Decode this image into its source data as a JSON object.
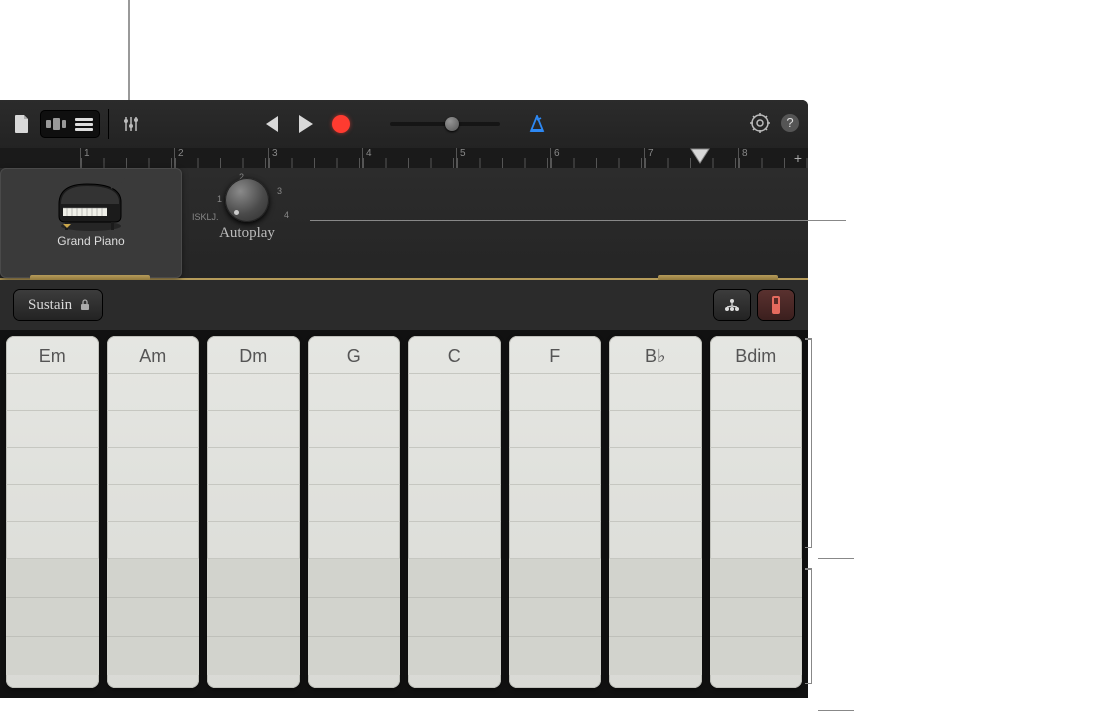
{
  "toolbar": {
    "my_songs_icon": "document",
    "browser_icon": "browser",
    "tracks_icon": "tracks",
    "mixer_icon": "mixer",
    "rewind_icon": "rewind",
    "play_icon": "play",
    "record_icon": "record",
    "metronome_icon": "metronome",
    "settings_icon": "settings",
    "help_icon": "help"
  },
  "ruler": {
    "bars": [
      "1",
      "2",
      "3",
      "4",
      "5",
      "6",
      "7",
      "8"
    ],
    "playhead_bar": 7.9,
    "add_icon": "+"
  },
  "instrument": {
    "name": "Grand Piano"
  },
  "autoplay": {
    "label": "Autoplay",
    "off_label": "ISKLJ.",
    "positions": [
      "1",
      "2",
      "3",
      "4"
    ],
    "current": 0
  },
  "sustain": {
    "label": "Sustain",
    "locked": true
  },
  "view_toggle": {
    "chord_icon": "chord-strips",
    "keyboard_icon": "keyboard"
  },
  "chords": [
    "Em",
    "Am",
    "Dm",
    "G",
    "C",
    "F",
    "B♭",
    "Bdim"
  ],
  "strip_layout": {
    "chord_rows": 5,
    "bass_rows": 3
  }
}
